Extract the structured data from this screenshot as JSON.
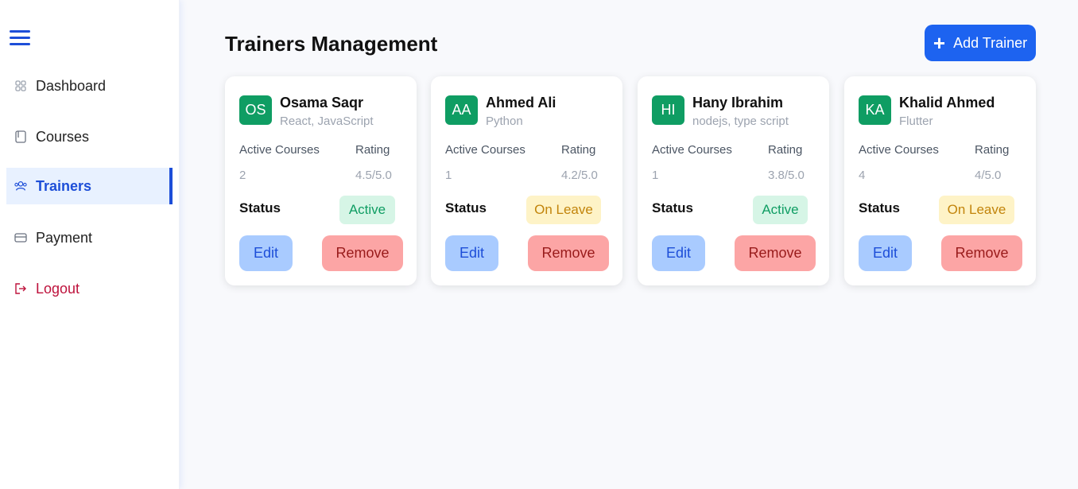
{
  "sidebar": {
    "items": [
      {
        "label": "Dashboard",
        "icon": "grid-icon"
      },
      {
        "label": "Courses",
        "icon": "book-icon"
      },
      {
        "label": "Trainers",
        "icon": "users-icon"
      },
      {
        "label": "Payment",
        "icon": "card-icon"
      },
      {
        "label": "Logout",
        "icon": "logout-icon"
      }
    ],
    "active_item": "Trainers"
  },
  "header": {
    "title": "Trainers Management",
    "add_button_label": "Add Trainer"
  },
  "labels": {
    "active_courses": "Active Courses",
    "rating": "Rating",
    "status": "Status",
    "edit": "Edit",
    "remove": "Remove"
  },
  "trainers": [
    {
      "initials": "OS",
      "name": "Osama Saqr",
      "skills": "React, JavaScript",
      "active_courses": "2",
      "rating": "4.5/5.0",
      "status": "Active"
    },
    {
      "initials": "AA",
      "name": "Ahmed Ali",
      "skills": "Python",
      "active_courses": "1",
      "rating": "4.2/5.0",
      "status": "On Leave"
    },
    {
      "initials": "HI",
      "name": "Hany Ibrahim",
      "skills": "nodejs, type script",
      "active_courses": "1",
      "rating": "3.8/5.0",
      "status": "Active"
    },
    {
      "initials": "KA",
      "name": "Khalid Ahmed",
      "skills": "Flutter",
      "active_courses": "4",
      "rating": "4/5.0",
      "status": "On Leave"
    }
  ],
  "colors": {
    "primary": "#1d63f0",
    "avatar": "#0f9d63",
    "active_badge_bg": "#d6f5e6",
    "leave_badge_bg": "#fef3c7",
    "edit_bg": "#a9cbff",
    "remove_bg": "#fca5a5",
    "logout": "#be123c"
  }
}
